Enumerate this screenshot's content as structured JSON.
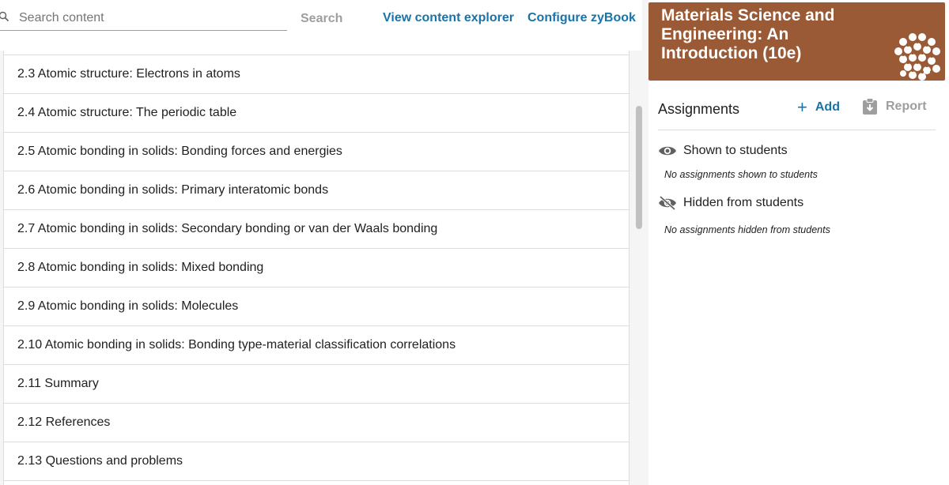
{
  "topbar": {
    "search_placeholder": "Search content",
    "search_button": "Search",
    "view_explorer": "View content explorer",
    "configure": "Configure zyBook"
  },
  "sections": [
    "2.3 Atomic structure: Electrons in atoms",
    "2.4 Atomic structure: The periodic table",
    "2.5 Atomic bonding in solids: Bonding forces and energies",
    "2.6 Atomic bonding in solids: Primary interatomic bonds",
    "2.7 Atomic bonding in solids: Secondary bonding or van der Waals bonding",
    "2.8 Atomic bonding in solids: Mixed bonding",
    "2.9 Atomic bonding in solids: Molecules",
    "2.10 Atomic bonding in solids: Bonding type-material classification correlations",
    "2.11 Summary",
    "2.12 References",
    "2.13 Questions and problems"
  ],
  "book": {
    "title": "Materials Science and Engineering: An Introduction (10e)",
    "logo_icon": "molecule-lattice-icon",
    "header_color": "#9a5a36"
  },
  "assignments": {
    "title": "Assignments",
    "add_label": "Add",
    "report_label": "Report",
    "shown_label": "Shown to students",
    "shown_empty": "No assignments shown to students",
    "hidden_label": "Hidden from students",
    "hidden_empty": "No assignments hidden from students"
  },
  "colors": {
    "link": "#1a73a8",
    "muted": "#9e9e9e"
  }
}
